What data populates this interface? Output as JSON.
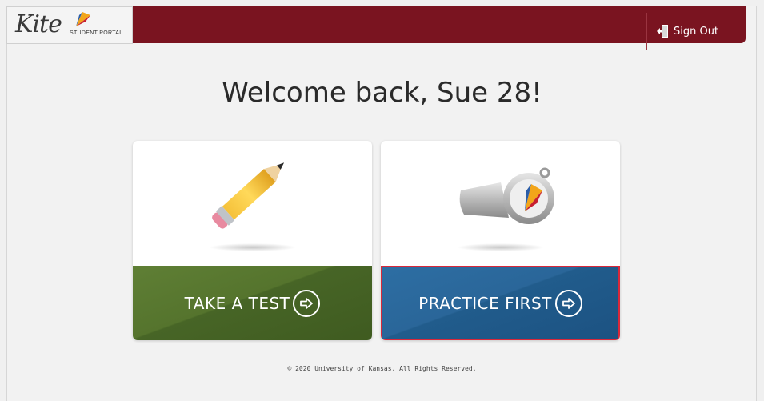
{
  "brand": {
    "name": "Kite",
    "subtitle": "STUDENT PORTAL"
  },
  "header": {
    "signout_label": "Sign Out",
    "color": "#7a1420"
  },
  "welcome": {
    "text": "Welcome back, Sue 28!"
  },
  "cards": {
    "take": {
      "label": "TAKE A TEST",
      "color": "#55742d",
      "icon": "pencil-icon"
    },
    "practice": {
      "label": "PRACTICE FIRST",
      "color": "#2a6699",
      "icon": "whistle-icon",
      "focused_border": "#d9283a"
    }
  },
  "footer": {
    "copyright": "© 2020 University of Kansas. All Rights Reserved."
  }
}
